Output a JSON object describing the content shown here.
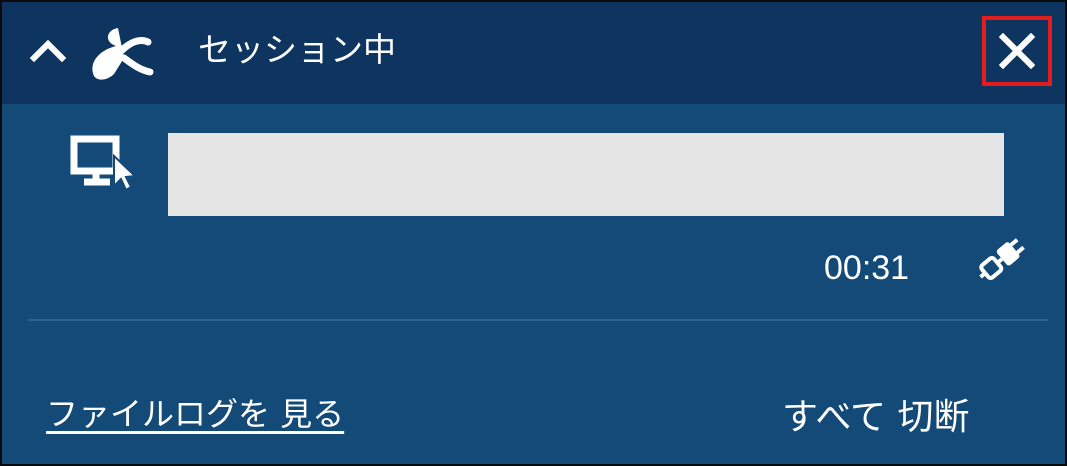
{
  "titlebar": {
    "title": "セッション中",
    "collapse_icon": "chevron-up-icon",
    "logo_icon": "splashtop-logo-icon",
    "close_icon": "close-icon"
  },
  "session": {
    "remote_icon": "remote-desktop-icon",
    "computer_name": "",
    "elapsed_time": "00:31",
    "connection_icon": "plug-connection-icon"
  },
  "footer": {
    "file_log_link": "ファイルログを 見る",
    "disconnect_all_label": "すべて 切断"
  },
  "colors": {
    "panel_bg": "#144a78",
    "titlebar_bg": "#0e3560",
    "field_bg": "#e5e5e5",
    "highlight_border": "#e31d1d",
    "text": "#ffffff"
  }
}
